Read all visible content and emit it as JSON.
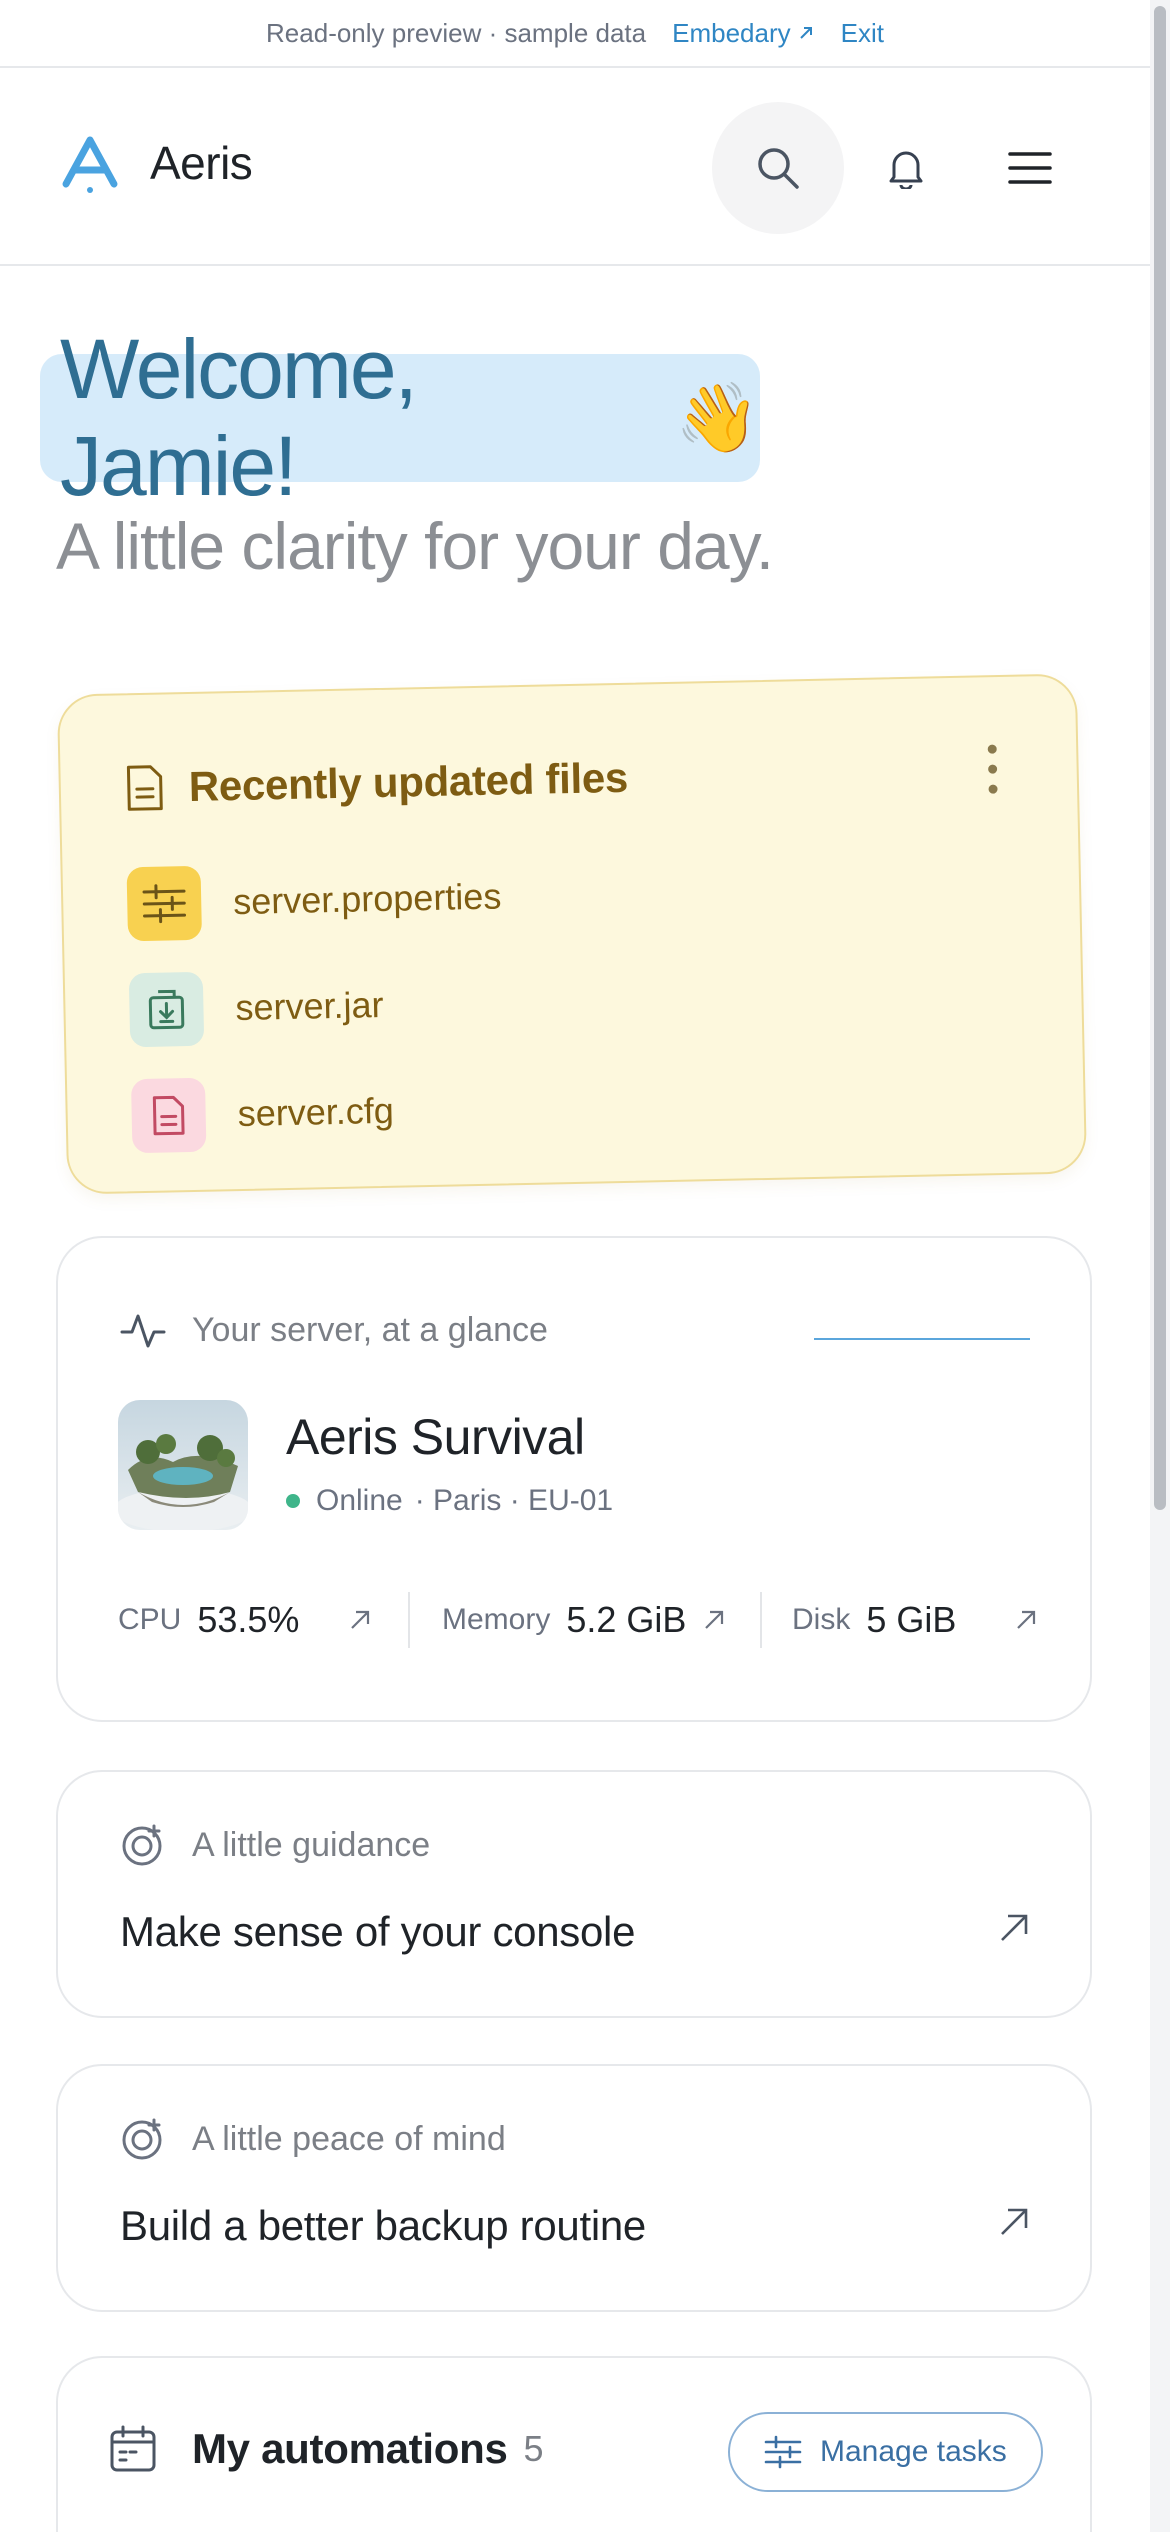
{
  "banner": {
    "text": "Read-only preview · sample data",
    "link_label": "Embedary",
    "exit_label": "Exit"
  },
  "header": {
    "brand": "Aeris",
    "icons": [
      "search-icon",
      "bell-icon",
      "menu-icon"
    ]
  },
  "welcome": {
    "greeting": "Welcome, Jamie!",
    "emoji": "👋",
    "subtitle": "A little clarity for your day."
  },
  "files": {
    "title": "Recently updated files",
    "items": [
      {
        "name": "server.properties",
        "icon": "sliders-icon",
        "color": "#f8d150"
      },
      {
        "name": "server.jar",
        "icon": "archive-icon",
        "color": "#d9ece2"
      },
      {
        "name": "server.cfg",
        "icon": "document-icon",
        "color": "#fbd9e0"
      }
    ]
  },
  "server": {
    "eyebrow": "Your server, at a glance",
    "name": "Aeris Survival",
    "status": "Online",
    "location": "· Paris · EU-01",
    "status_color": "#3fb58a",
    "stats": [
      {
        "label": "CPU",
        "value": "53.5%"
      },
      {
        "label": "Memory",
        "value": "5.2 GiB"
      },
      {
        "label": "Disk",
        "value": "5 GiB"
      }
    ]
  },
  "guides": [
    {
      "eyebrow": "A little guidance",
      "title": "Make sense of your console"
    },
    {
      "eyebrow": "A little peace of mind",
      "title": "Build a better backup routine"
    }
  ],
  "automations": {
    "title": "My automations",
    "count": "5",
    "button_label": "Manage tasks"
  }
}
